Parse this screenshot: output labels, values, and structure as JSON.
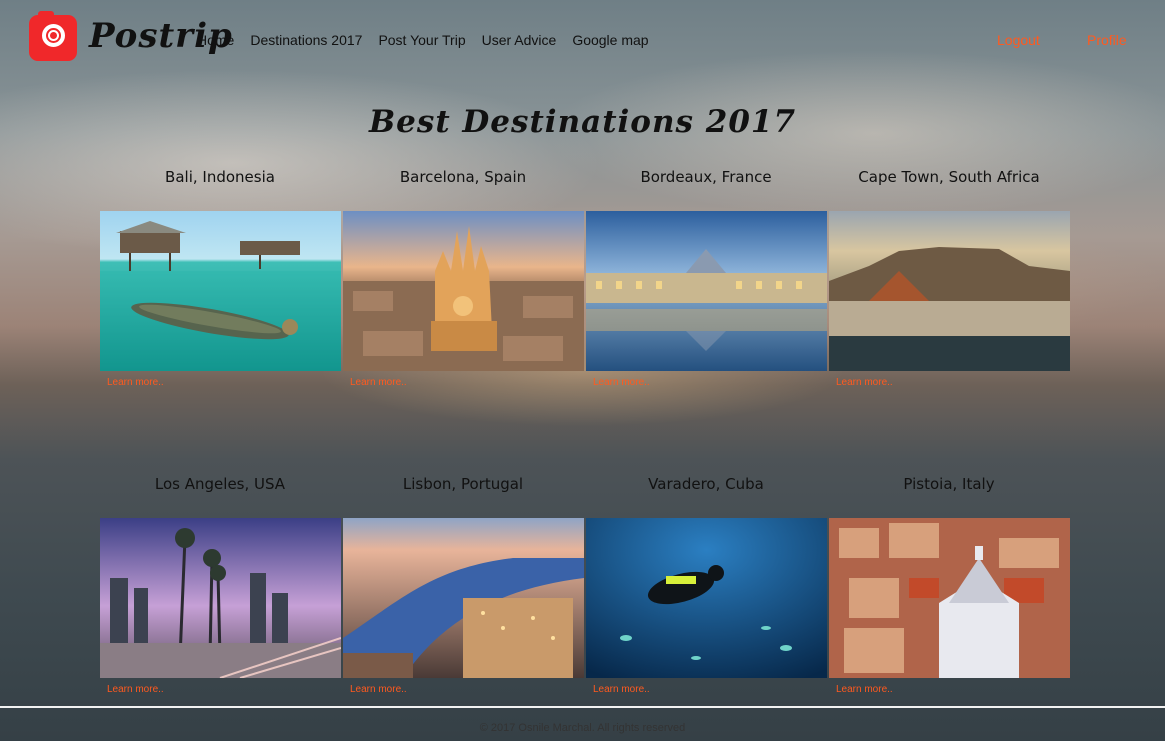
{
  "header": {
    "logo_text": "Postrip",
    "nav": [
      "Home",
      "Destinations 2017",
      "Post Your Trip",
      "User Advice",
      "Google map"
    ],
    "logout": "Logout",
    "profile": "Profile"
  },
  "page": {
    "title": "Best Destinations 2017"
  },
  "destinations": [
    {
      "name": "Bali, Indonesia",
      "link": "Learn more..",
      "image": "bali-stilt-houses-canoe-photo"
    },
    {
      "name": "Barcelona, Spain",
      "link": "Learn more..",
      "image": "barcelona-sagrada-familia-photo"
    },
    {
      "name": "Bordeaux, France",
      "link": "Learn more..",
      "image": "bordeaux-water-mirror-photo"
    },
    {
      "name": "Cape Town, South Africa",
      "link": "Learn more..",
      "image": "cape-town-table-mountain-photo"
    },
    {
      "name": "Los Angeles, USA",
      "link": "Learn more..",
      "image": "los-angeles-palms-freeway-photo"
    },
    {
      "name": "Lisbon, Portugal",
      "link": "Learn more..",
      "image": "lisbon-river-dusk-photo"
    },
    {
      "name": "Varadero, Cuba",
      "link": "Learn more..",
      "image": "varadero-scuba-diver-photo"
    },
    {
      "name": "Pistoia, Italy",
      "link": "Learn more..",
      "image": "pistoia-rooftops-baptistery-photo"
    }
  ],
  "footer": {
    "text": "© 2017 Osnile Marchal. All rights reserved"
  },
  "colors": {
    "accent": "#ff5a1f",
    "logo": "#f0282a"
  }
}
